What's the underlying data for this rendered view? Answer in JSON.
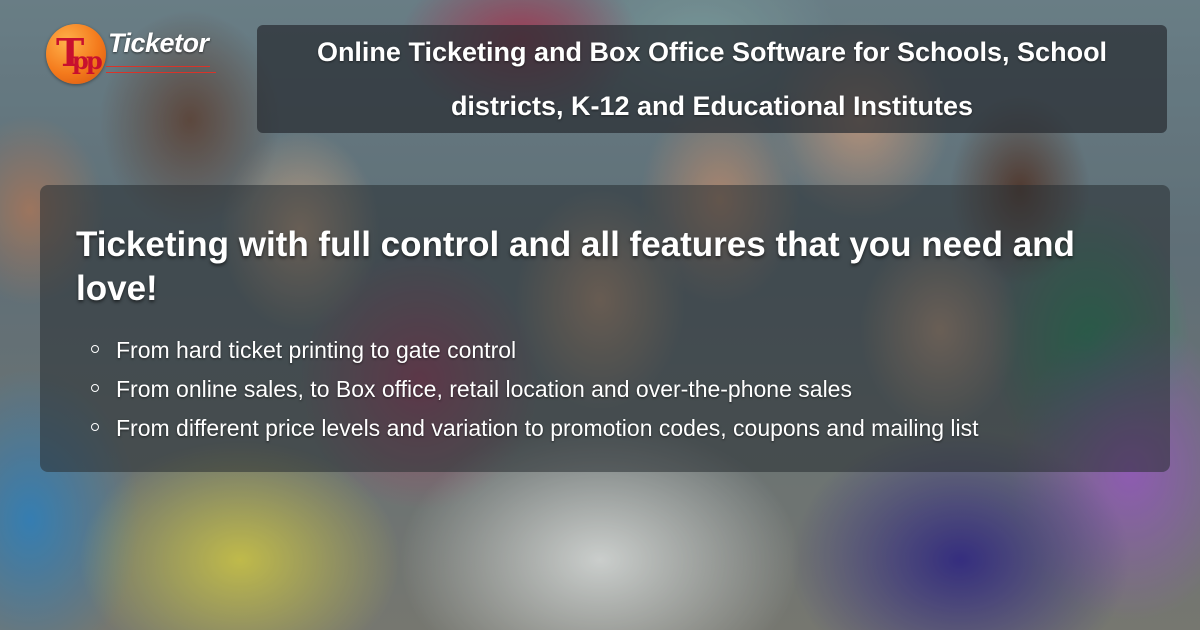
{
  "logo": {
    "text": "Ticketor",
    "icon": "ticketor-logo-icon",
    "brand_color": "#f47a1c"
  },
  "header": {
    "title": "Online Ticketing and Box Office Software for Schools, School districts, K-12 and Educational Institutes"
  },
  "features": {
    "heading": "Ticketing with full control and all features that you need and love!",
    "items": [
      "From hard ticket printing to gate control",
      "From online sales, to Box office, retail location and over-the-phone sales",
      "From different price levels and variation to promotion codes, coupons and mailing list"
    ]
  },
  "background": {
    "icon": "crowd-photo",
    "overlay_color": "#282d32"
  }
}
